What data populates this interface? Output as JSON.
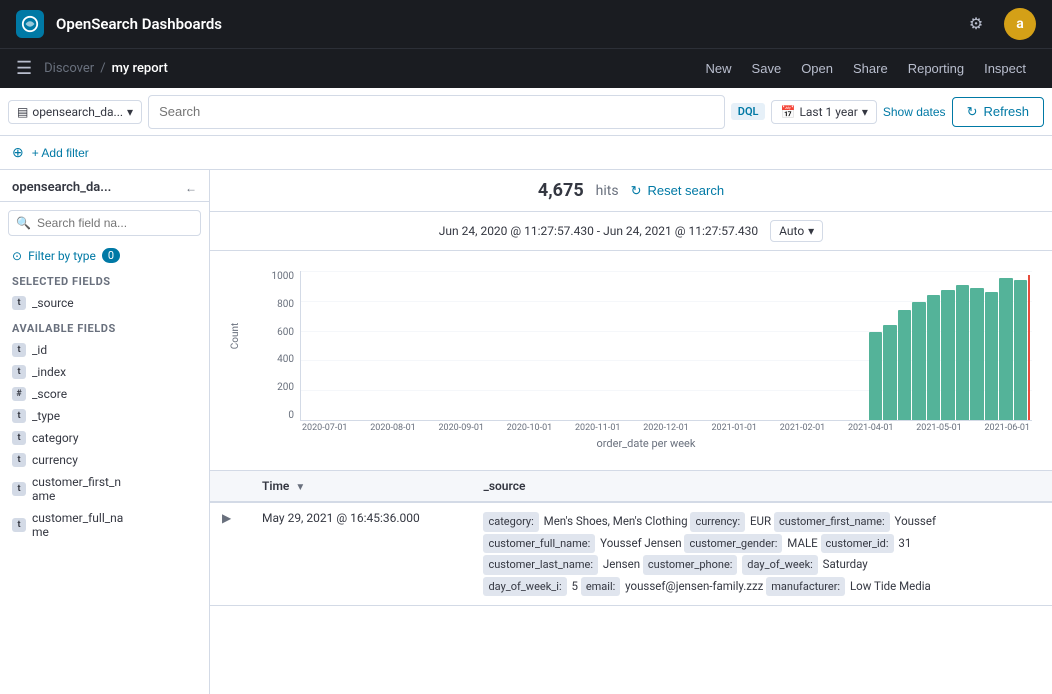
{
  "app": {
    "title": "OpenSearch Dashboards",
    "logo_letter": "O",
    "settings_icon": "⚙",
    "avatar_letter": "a"
  },
  "nav": {
    "hamburger": "☰",
    "breadcrumb_parent": "Discover",
    "breadcrumb_sep": "/",
    "breadcrumb_current": "my report",
    "new_label": "New",
    "save_label": "Save",
    "open_label": "Open",
    "share_label": "Share",
    "reporting_label": "Reporting",
    "inspect_label": "Inspect"
  },
  "search_bar": {
    "index_label": "opensearch_da...",
    "search_placeholder": "Search",
    "dql_label": "DQL",
    "calendar_icon": "📅",
    "time_range": "Last 1 year",
    "show_dates_label": "Show dates",
    "refresh_label": "Refresh",
    "refresh_icon": "↻"
  },
  "filter_row": {
    "filter_icon": "⊕",
    "add_filter_label": "+ Add filter"
  },
  "sidebar": {
    "index_name": "opensearch_da...",
    "collapse_icon": "←",
    "search_placeholder": "Search field na...",
    "filter_type_label": "Filter by type",
    "filter_count": "0",
    "selected_fields_label": "Selected fields",
    "selected_fields": [
      {
        "name": "_source",
        "type": "t"
      }
    ],
    "available_fields_label": "Available fields",
    "available_fields": [
      {
        "name": "_id",
        "type": "t"
      },
      {
        "name": "_index",
        "type": "t"
      },
      {
        "name": "_score",
        "type": "#"
      },
      {
        "name": "_type",
        "type": "t"
      },
      {
        "name": "category",
        "type": "t"
      },
      {
        "name": "currency",
        "type": "t"
      },
      {
        "name": "customer_first_n\name",
        "type": "t"
      },
      {
        "name": "customer_full_na\nme",
        "type": "t"
      }
    ]
  },
  "results": {
    "hits_count": "4,675",
    "hits_label": "hits",
    "reset_search_label": "Reset search",
    "date_range": "Jun 24, 2020 @ 11:27:57.430 - Jun 24, 2021 @ 11:27:57.430",
    "auto_label": "Auto",
    "chart_title": "order_date per week",
    "chart_y_labels": [
      "1000",
      "800",
      "600",
      "400",
      "200",
      "0"
    ],
    "chart_x_labels": [
      "2020-07-01",
      "2020-08-01",
      "2020-09-01",
      "2020-10-01",
      "2020-11-01",
      "2020-12-01",
      "2021-01-01",
      "2021-02-01",
      "",
      "2021-04-01",
      "2021-05-01",
      "2021-06-01"
    ],
    "chart_y_axis_label": "Count",
    "chart_bars": [
      0,
      0,
      0,
      0,
      0,
      0,
      0,
      0,
      0,
      0,
      0,
      0,
      0,
      0,
      0,
      0,
      0,
      0,
      0,
      0,
      0,
      0,
      0,
      0,
      0,
      0,
      0,
      0,
      0,
      0,
      0,
      0,
      0,
      0,
      0,
      0,
      0,
      0,
      0,
      45,
      55,
      65,
      75,
      85,
      90,
      95,
      92,
      88,
      100,
      98
    ],
    "table_columns": [
      "Time",
      "_source"
    ],
    "table_rows": [
      {
        "time": "May 29, 2021 @ 16:45:36.000",
        "source_fields": [
          {
            "key": "category:",
            "value": "Men's Shoes, Men's Clothing",
            "highlight": true
          },
          {
            "key": "currency:",
            "value": "EUR"
          },
          {
            "key": "customer_first_name:",
            "value": "Youssef"
          },
          {
            "key": "customer_full_name:",
            "value": "Youssef Jensen"
          },
          {
            "key": "customer_gender:",
            "value": "MALE"
          },
          {
            "key": "customer_id:",
            "value": "31"
          },
          {
            "key": "customer_last_name:",
            "value": "Jensen"
          },
          {
            "key": "customer_phone:",
            "value": ""
          },
          {
            "key": "day_of_week:",
            "value": "Saturday"
          },
          {
            "key": "day_of_week_i:",
            "value": "5"
          },
          {
            "key": "email:",
            "value": "youssef@jensen-family.zzz"
          },
          {
            "key": "manufacturer:",
            "value": "Low Tide Media"
          }
        ]
      }
    ]
  }
}
